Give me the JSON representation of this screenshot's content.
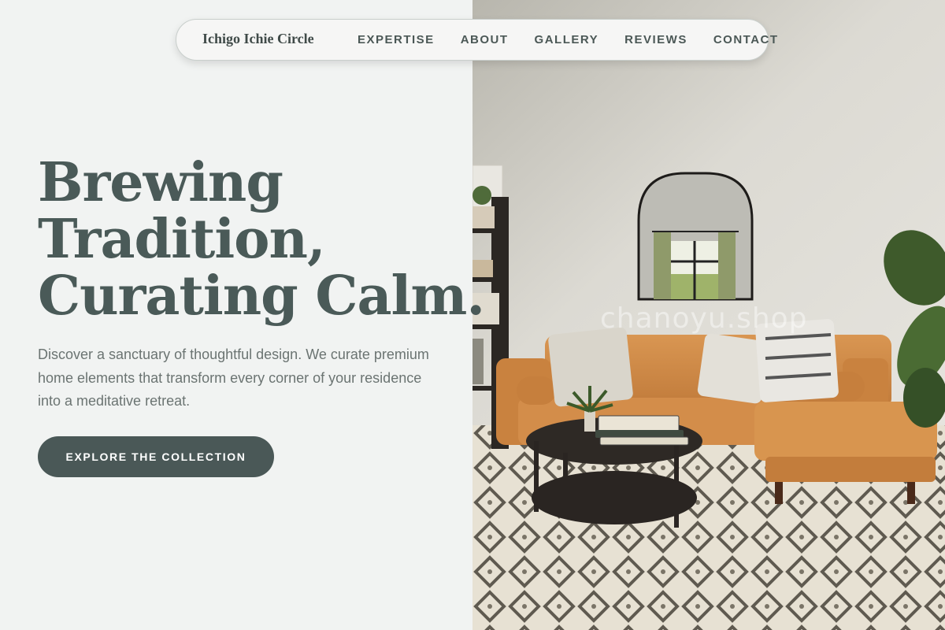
{
  "nav": {
    "brand": "Ichigo Ichie Circle",
    "links": [
      "EXPERTISE",
      "ABOUT",
      "GALLERY",
      "REVIEWS",
      "CONTACT"
    ]
  },
  "hero": {
    "title_lines": [
      "Brewing",
      "Tradition,",
      "Curating Calm."
    ],
    "description": "Discover a sanctuary of thoughtful design. We curate premium home elements that transform every corner of your residence into a meditative retreat.",
    "cta_label": "EXPLORE THE COLLECTION"
  },
  "photo": {
    "description_icon": "living-room-photo",
    "watermark": "chanoyu.shop"
  },
  "colors": {
    "background": "#f1f3f2",
    "heading": "#4a5a58",
    "body_text": "#6b7472",
    "cta_background": "#4a5857",
    "sofa": "#d08a4a"
  }
}
